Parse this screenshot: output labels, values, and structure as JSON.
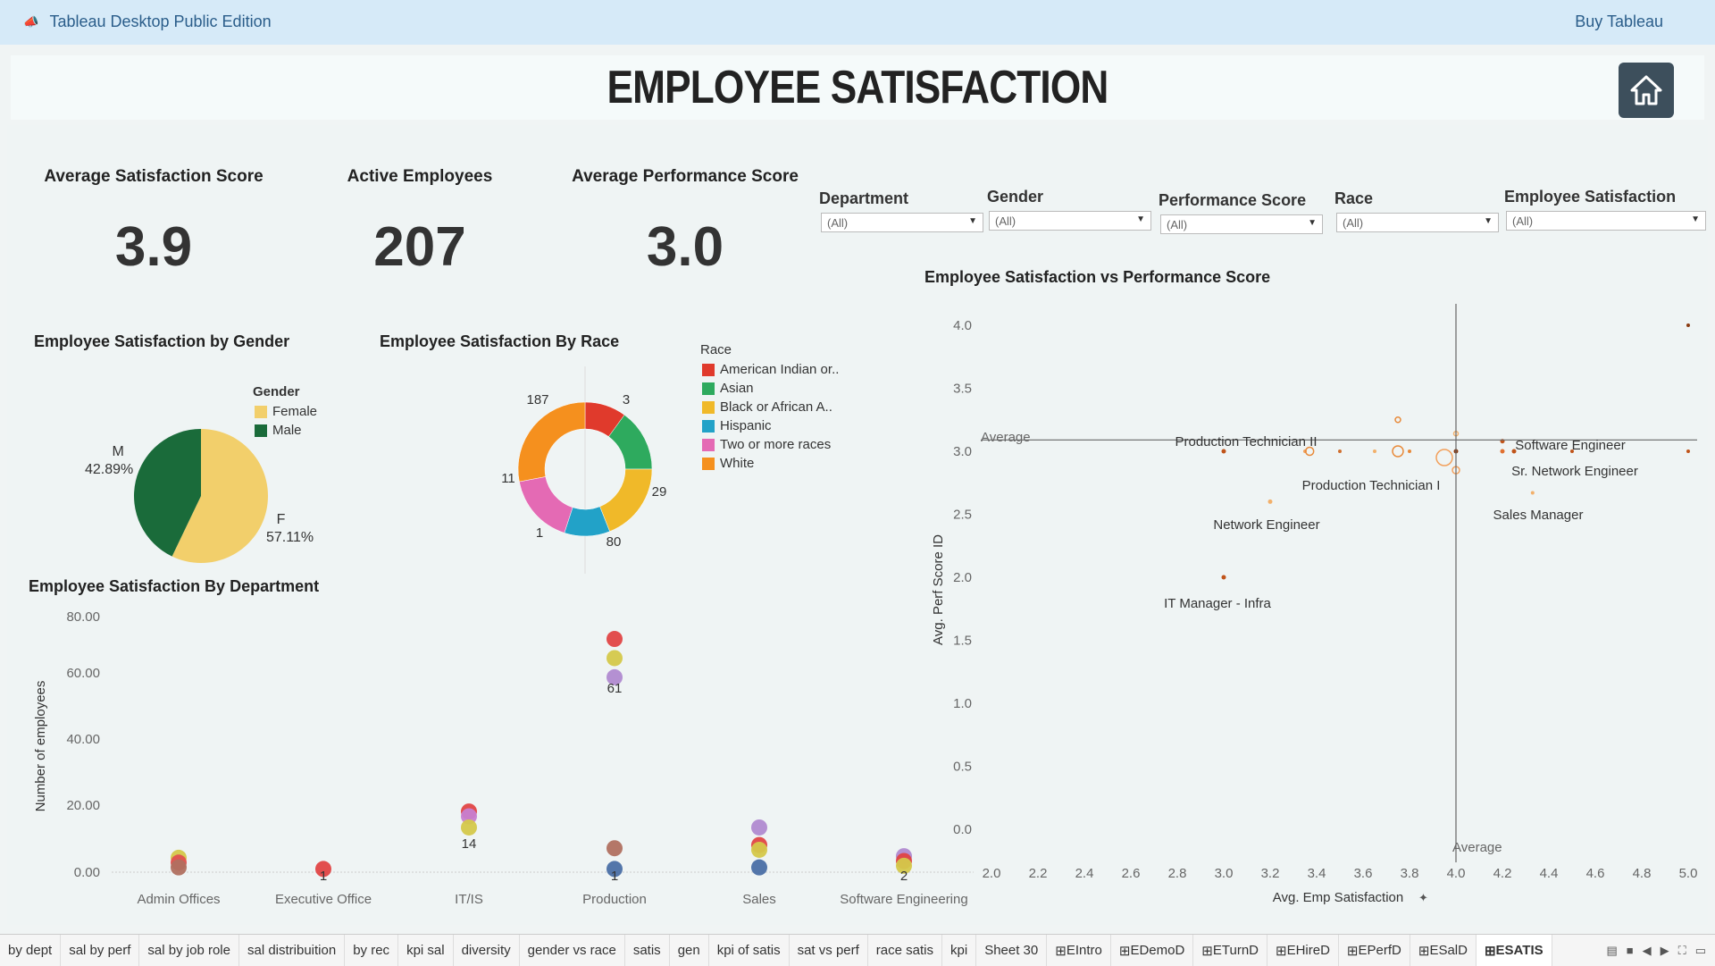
{
  "topbar": {
    "app_title": "Tableau Desktop Public Edition",
    "buy_label": "Buy Tableau"
  },
  "dashboard": {
    "title": "EMPLOYEE SATISFACTION"
  },
  "kpis": [
    {
      "label": "Average Satisfaction Score",
      "value": "3.9"
    },
    {
      "label": "Active Employees",
      "value": "207"
    },
    {
      "label": "Average Performance Score",
      "value": "3.0"
    }
  ],
  "filters": [
    {
      "label": "Department",
      "value": "(All)"
    },
    {
      "label": "Gender",
      "value": "(All)"
    },
    {
      "label": "Performance Score",
      "value": "(All)"
    },
    {
      "label": "Race",
      "value": "(All)"
    },
    {
      "label": "Employee Satisfaction",
      "value": "(All)"
    }
  ],
  "gender_chart": {
    "title": "Employee Satisfaction by Gender",
    "legend_title": "Gender",
    "legend": [
      {
        "label": "Female",
        "color": "#f2cf6b"
      },
      {
        "label": "Male",
        "color": "#1a6b3a"
      }
    ],
    "slice_labels": [
      {
        "abbr": "M",
        "pct": "42.89%"
      },
      {
        "abbr": "F",
        "pct": "57.11%"
      }
    ]
  },
  "race_chart": {
    "title": "Employee Satisfaction By Race",
    "legend_title": "Race",
    "legend": [
      {
        "label": "American Indian or..",
        "color": "#e03a2c"
      },
      {
        "label": "Asian",
        "color": "#2eaa5e"
      },
      {
        "label": "Black or African A..",
        "color": "#f0b929"
      },
      {
        "label": "Hispanic",
        "color": "#22a2c8"
      },
      {
        "label": "Two or more races",
        "color": "#e46ab4"
      },
      {
        "label": "White",
        "color": "#f5901e"
      }
    ],
    "labels": [
      "3",
      "29",
      "80",
      "1",
      "11",
      "187"
    ]
  },
  "dept_chart": {
    "title": "Employee Satisfaction By Department",
    "ylabel": "Number of employees",
    "yticks": [
      "80.00",
      "60.00",
      "40.00",
      "20.00",
      "0.00"
    ],
    "categories": [
      "Admin Offices",
      "Executive Office",
      "IT/IS",
      "Production",
      "Sales",
      "Software Engineering"
    ],
    "point_labels": [
      "1",
      "14",
      "61",
      "1",
      "2"
    ]
  },
  "scatter_chart": {
    "title": "Employee Satisfaction vs Performance Score",
    "xlabel": "Avg. Emp Satisfaction",
    "ylabel": "Avg. Perf Score ID",
    "xticks": [
      "2.0",
      "2.2",
      "2.4",
      "2.6",
      "2.8",
      "3.0",
      "3.2",
      "3.4",
      "3.6",
      "3.8",
      "4.0",
      "4.2",
      "4.4",
      "4.6",
      "4.8",
      "5.0"
    ],
    "yticks": [
      "4.0",
      "3.5",
      "3.0",
      "2.5",
      "2.0",
      "1.5",
      "1.0",
      "0.5",
      "0.0"
    ],
    "ref_label_h": "Average",
    "ref_label_v": "Average",
    "annotations": [
      "Production Technician II",
      "Software Engineer",
      "Sr. Network Engineer",
      "Production Technician I",
      "Sales Manager",
      "Network Engineer",
      "IT Manager - Infra"
    ]
  },
  "chart_data": [
    {
      "type": "pie",
      "title": "Employee Satisfaction by Gender",
      "categories": [
        "Female",
        "Male"
      ],
      "values": [
        57.11,
        42.89
      ]
    },
    {
      "type": "pie",
      "title": "Employee Satisfaction By Race",
      "categories": [
        "American Indian or..",
        "Asian",
        "Black or African A..",
        "Hispanic",
        "Two or more races",
        "White"
      ],
      "values": [
        3,
        29,
        80,
        1,
        11,
        187
      ]
    },
    {
      "type": "scatter",
      "title": "Employee Satisfaction By Department",
      "categories": [
        "Admin Offices",
        "Executive Office",
        "IT/IS",
        "Production",
        "Sales",
        "Software Engineering"
      ],
      "ylabel": "Number of employees",
      "ylim": [
        0,
        80
      ],
      "points": [
        {
          "category": "Admin Offices",
          "y": 4.5,
          "color": "#d4c84a"
        },
        {
          "category": "Admin Offices",
          "y": 3,
          "color": "#e05050"
        },
        {
          "category": "Admin Offices",
          "y": 1.5,
          "color": "#b07060"
        },
        {
          "category": "Executive Office",
          "y": 1,
          "color": "#e04545"
        },
        {
          "category": "IT/IS",
          "y": 19,
          "color": "#e04545"
        },
        {
          "category": "IT/IS",
          "y": 17.5,
          "color": "#c77fd0"
        },
        {
          "category": "IT/IS",
          "y": 14,
          "color": "#d4c84a"
        },
        {
          "category": "Production",
          "y": 73,
          "color": "#e04545"
        },
        {
          "category": "Production",
          "y": 67,
          "color": "#d4c84a"
        },
        {
          "category": "Production",
          "y": 61,
          "color": "#b08ad0"
        },
        {
          "category": "Production",
          "y": 7.5,
          "color": "#b07060"
        },
        {
          "category": "Production",
          "y": 1,
          "color": "#4a6fa5"
        },
        {
          "category": "Sales",
          "y": 14,
          "color": "#b08ad0"
        },
        {
          "category": "Sales",
          "y": 8.5,
          "color": "#e04545"
        },
        {
          "category": "Sales",
          "y": 7,
          "color": "#d4c84a"
        },
        {
          "category": "Sales",
          "y": 1.5,
          "color": "#4a6fa5"
        },
        {
          "category": "Software Engineering",
          "y": 5,
          "color": "#b08ad0"
        },
        {
          "category": "Software Engineering",
          "y": 3.5,
          "color": "#e04545"
        },
        {
          "category": "Software Engineering",
          "y": 2,
          "color": "#d4c84a"
        }
      ]
    },
    {
      "type": "scatter",
      "title": "Employee Satisfaction vs Performance Score",
      "xlabel": "Avg. Emp Satisfaction",
      "ylabel": "Avg. Perf Score ID",
      "xlim": [
        2.0,
        5.0
      ],
      "ylim": [
        0.0,
        4.1
      ],
      "reference_lines": {
        "x": 4.0,
        "y": 3.09
      },
      "points": [
        {
          "x": 3.0,
          "y": 3.0,
          "r": 2.5,
          "color": "#c0541a"
        },
        {
          "x": 3.0,
          "y": 2.0,
          "r": 2.5,
          "color": "#c0541a"
        },
        {
          "x": 3.2,
          "y": 2.6,
          "r": 2.5,
          "color": "#f2b06b"
        },
        {
          "x": 3.35,
          "y": 3.0,
          "r": 2,
          "color": "#f2a05b"
        },
        {
          "x": 3.37,
          "y": 3.0,
          "r": 4.5,
          "color": "#e88a3a",
          "hollow": true
        },
        {
          "x": 3.5,
          "y": 3.0,
          "r": 2,
          "color": "#d07030"
        },
        {
          "x": 3.65,
          "y": 3.0,
          "r": 2,
          "color": "#f2b06b"
        },
        {
          "x": 3.75,
          "y": 3.0,
          "r": 6,
          "color": "#e88a3a",
          "hollow": true
        },
        {
          "x": 3.75,
          "y": 3.25,
          "r": 3,
          "color": "#e88a3a",
          "hollow": true
        },
        {
          "x": 3.8,
          "y": 3.0,
          "r": 2,
          "color": "#e88a3a"
        },
        {
          "x": 3.95,
          "y": 2.95,
          "r": 9,
          "color": "#f2a05b",
          "hollow": true
        },
        {
          "x": 4.0,
          "y": 3.0,
          "r": 2.5,
          "color": "#8a3a10"
        },
        {
          "x": 4.0,
          "y": 3.14,
          "r": 2.5,
          "color": "#f2b06b",
          "hollow": true
        },
        {
          "x": 4.0,
          "y": 2.85,
          "r": 4,
          "color": "#f2a05b",
          "hollow": true
        },
        {
          "x": 4.2,
          "y": 3.08,
          "r": 2.5,
          "color": "#c0541a"
        },
        {
          "x": 4.2,
          "y": 3.0,
          "r": 2.5,
          "color": "#e07030"
        },
        {
          "x": 4.25,
          "y": 3.0,
          "r": 2.5,
          "color": "#c0541a"
        },
        {
          "x": 4.33,
          "y": 2.67,
          "r": 2,
          "color": "#f2b06b"
        },
        {
          "x": 4.5,
          "y": 3.0,
          "r": 2,
          "color": "#c0541a"
        },
        {
          "x": 5.0,
          "y": 3.0,
          "r": 2,
          "color": "#c0541a"
        },
        {
          "x": 5.0,
          "y": 4.0,
          "r": 2,
          "color": "#8a3a10"
        }
      ]
    }
  ],
  "tabs": [
    "by dept",
    "sal by perf",
    "sal by job role",
    "sal distribuition",
    "by rec",
    "kpi sal",
    "diversity",
    "gender vs race",
    "satis",
    "gen",
    "kpi of satis",
    "sat vs perf",
    "race satis",
    "kpi",
    "Sheet 30",
    "EIntro",
    "EDemoD",
    "ETurnD",
    "EHireD",
    "EPerfD",
    "ESalD",
    "ESATIS"
  ],
  "active_tab": "ESATIS"
}
